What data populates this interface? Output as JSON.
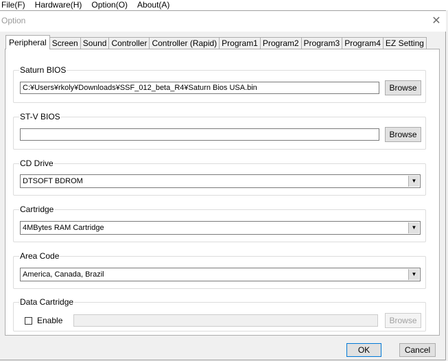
{
  "menubar": {
    "items": [
      "File(F)",
      "Hardware(H)",
      "Option(O)",
      "About(A)"
    ]
  },
  "window": {
    "title": "Option",
    "close_glyph": "✕"
  },
  "tabs": [
    "Peripheral",
    "Screen",
    "Sound",
    "Controller",
    "Controller (Rapid)",
    "Program1",
    "Program2",
    "Program3",
    "Program4",
    "EZ Setting"
  ],
  "active_tab": "Peripheral",
  "saturn_bios": {
    "label": "Saturn BIOS",
    "value": "C:¥Users¥rkoly¥Downloads¥SSF_012_beta_R4¥Saturn Bios USA.bin",
    "browse": "Browse"
  },
  "stv_bios": {
    "label": "ST-V BIOS",
    "value": "",
    "browse": "Browse"
  },
  "cd_drive": {
    "label": "CD Drive",
    "value": "DTSOFT  BDROM"
  },
  "cartridge": {
    "label": "Cartridge",
    "value": "4MBytes RAM Cartridge"
  },
  "area_code": {
    "label": "Area Code",
    "value": "America, Canada, Brazil"
  },
  "data_cartridge": {
    "label": "Data Cartridge",
    "enable_label": "Enable",
    "enabled": false,
    "value": "",
    "browse": "Browse"
  },
  "footer": {
    "ok": "OK",
    "cancel": "Cancel"
  },
  "icons": {
    "dropdown": "chevron-down-icon",
    "close": "close-icon"
  }
}
